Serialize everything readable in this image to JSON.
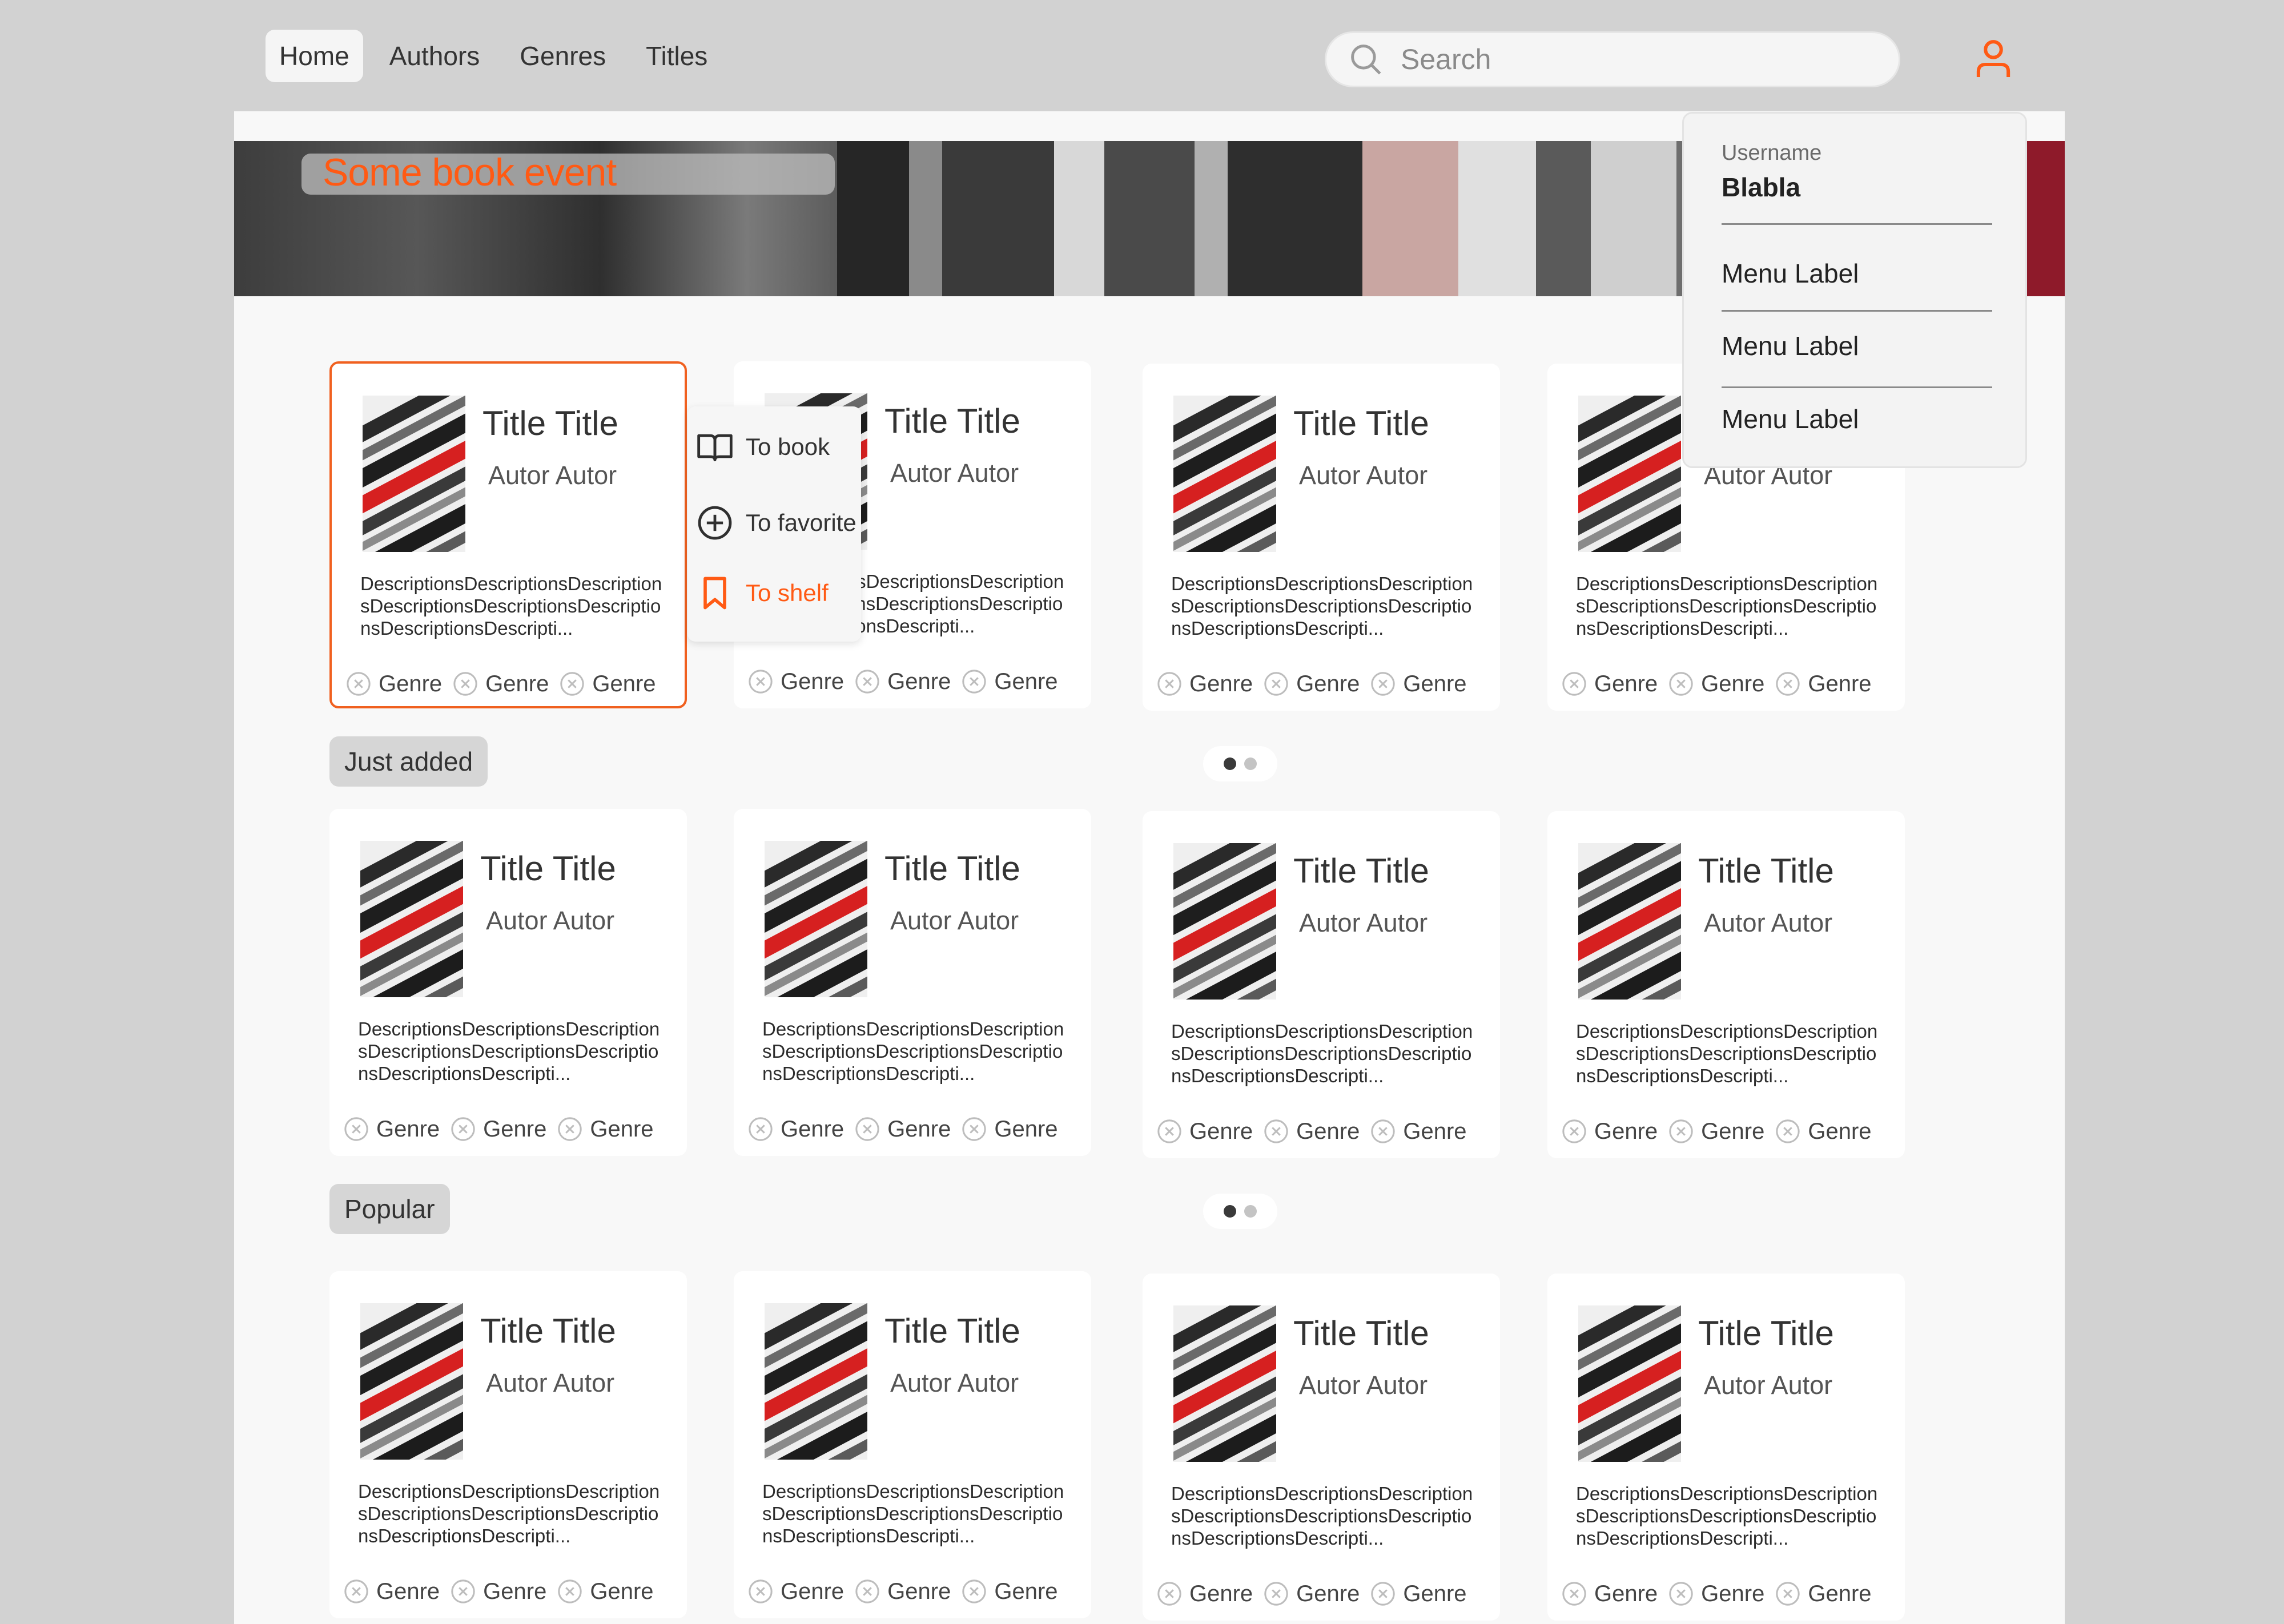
{
  "nav": {
    "items": [
      {
        "label": "Home",
        "active": true
      },
      {
        "label": "Authors",
        "active": false
      },
      {
        "label": "Genres",
        "active": false
      },
      {
        "label": "Titles",
        "active": false
      }
    ]
  },
  "search": {
    "placeholder": "Search"
  },
  "banner": {
    "title": "Some book event"
  },
  "book": {
    "title": "Title Title",
    "author": "Autor Autor",
    "description": "DescriptionsDescriptionsDescriptionsDescriptionsDescriptionsDescriptionsDescriptionsDescripti...",
    "genres": [
      "Genre",
      "Genre",
      "Genre"
    ]
  },
  "context_menu": {
    "items": [
      {
        "label": "To book",
        "icon": "book-open-icon"
      },
      {
        "label": "To favorite",
        "icon": "plus-circle-icon"
      },
      {
        "label": "To shelf",
        "icon": "bookmark-icon"
      }
    ]
  },
  "sections": [
    {
      "label": "Just added",
      "pager": {
        "pages": 2,
        "current": 1
      }
    },
    {
      "label": "Popular",
      "pager": {
        "pages": 2,
        "current": 1
      }
    }
  ],
  "user_menu": {
    "caption": "Username",
    "username": "Blabla",
    "items": [
      "Menu Label",
      "Menu Label",
      "Menu Label"
    ]
  },
  "colors": {
    "accent": "#ff5a14",
    "topbar": "#d2d2d2",
    "page": "#f8f8f8"
  }
}
